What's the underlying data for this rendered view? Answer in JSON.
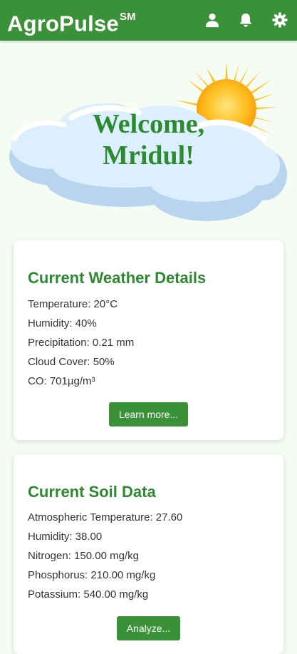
{
  "app": {
    "name": "AgroPulse",
    "mark": "SM"
  },
  "header": {
    "icons": [
      "user-icon",
      "bell-icon",
      "gear-icon"
    ]
  },
  "hero": {
    "greeting_line1": "Welcome,",
    "greeting_line2": "Mridul!"
  },
  "weather": {
    "title": "Current Weather Details",
    "rows": [
      "Temperature: 20°C",
      "Humidity: 40%",
      "Precipitation: 0.21 mm",
      "Cloud Cover: 50%",
      "CO: 701µg/m³"
    ],
    "button": "Learn more..."
  },
  "soil": {
    "title": "Current Soil Data",
    "rows": [
      "Atmospheric Temperature: 27.60",
      "Humidity: 38.00",
      "Nitrogen: 150.00 mg/kg",
      "Phosphorus: 210.00 mg/kg",
      "Potassium: 540.00 mg/kg"
    ],
    "button": "Analyze..."
  },
  "colors": {
    "brand": "#3a9138",
    "heading": "#2e8a30",
    "background": "#f4fcf4"
  }
}
